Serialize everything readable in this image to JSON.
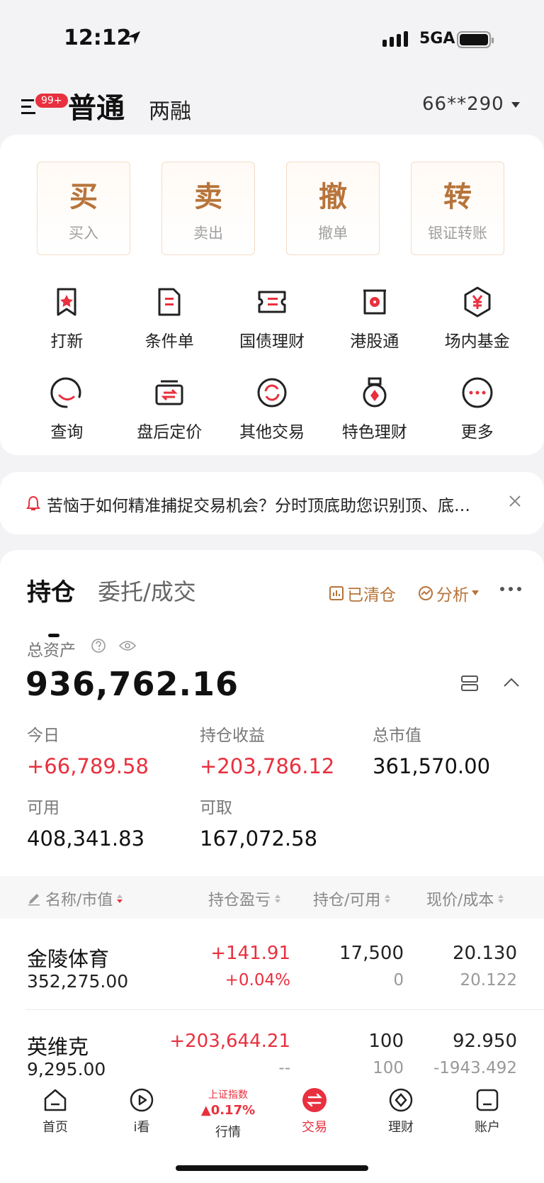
{
  "status_bar": {
    "time": "12:12",
    "network": "5GA"
  },
  "top_nav": {
    "badge": "99+",
    "tab_active": "普通",
    "tab_second": "两融",
    "account": "66**290"
  },
  "quick_actions": [
    {
      "main": "买",
      "sub": "买入"
    },
    {
      "main": "卖",
      "sub": "卖出"
    },
    {
      "main": "撤",
      "sub": "撤单"
    },
    {
      "main": "转",
      "sub": "银证转账"
    }
  ],
  "grid_items": [
    {
      "label": "打新",
      "icon": "ipo-bookmark-icon"
    },
    {
      "label": "条件单",
      "icon": "condition-order-icon"
    },
    {
      "label": "国债理财",
      "icon": "treasury-ticket-icon"
    },
    {
      "label": "港股通",
      "icon": "hk-connect-icon"
    },
    {
      "label": "场内基金",
      "icon": "yen-hexagon-icon"
    },
    {
      "label": "查询",
      "icon": "query-icon"
    },
    {
      "label": "盘后定价",
      "icon": "after-hours-icon"
    },
    {
      "label": "其他交易",
      "icon": "refresh-circle-icon"
    },
    {
      "label": "特色理财",
      "icon": "medal-icon"
    },
    {
      "label": "更多",
      "icon": "more-dots-icon"
    }
  ],
  "notice": {
    "text": "苦恼于如何精准捕捉交易机会？分时顶底助您识别顶、底信号"
  },
  "holdings": {
    "tab_active": "持仓",
    "tab_other": "委托/成交",
    "cleared_label": "已清仓",
    "analysis_label": "分析",
    "total_label": "总资产",
    "total_value": "936,762.16",
    "metrics": [
      {
        "label": "今日",
        "value": "+66,789.58"
      },
      {
        "label": "持仓收益",
        "value": "+203,786.12"
      },
      {
        "label": "总市值",
        "value": "361,570.00"
      },
      {
        "label": "可用",
        "value": "408,341.83"
      },
      {
        "label": "可取",
        "value": "167,072.58"
      }
    ],
    "columns": [
      "名称/市值",
      "持仓盈亏",
      "持仓/可用",
      "现价/成本"
    ],
    "rows": [
      {
        "name": "金陵体育",
        "market_value": "352,275.00",
        "pnl": "+141.91",
        "pnl_pct": "+0.04%",
        "position": "17,500",
        "available": "0",
        "price": "20.130",
        "cost": "20.122"
      },
      {
        "name": "英维克",
        "market_value": "9,295.00",
        "pnl": "+203,644.21",
        "pnl_pct": "--",
        "position": "100",
        "available": "100",
        "price": "92.950",
        "cost": "-1943.492"
      }
    ]
  },
  "tab_bar": {
    "items": [
      {
        "label": "首页"
      },
      {
        "label": "i看"
      },
      {
        "label": "行情",
        "index_name": "上证指数",
        "index_value": "0.17%"
      },
      {
        "label": "交易"
      },
      {
        "label": "理财"
      },
      {
        "label": "账户"
      }
    ]
  },
  "colors": {
    "accent": "#e8303e",
    "gold": "#b7743a"
  }
}
